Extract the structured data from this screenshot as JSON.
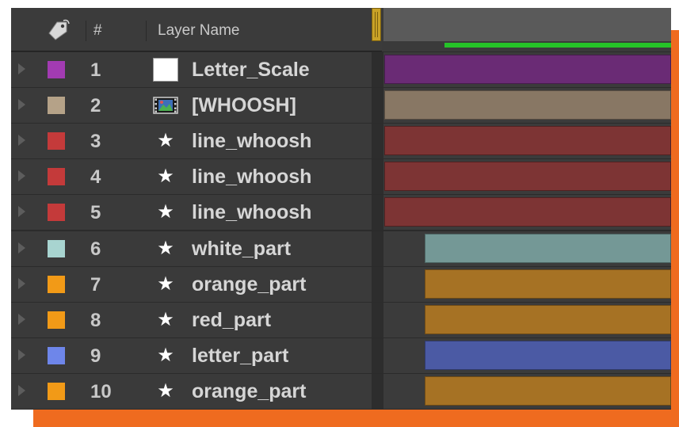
{
  "header": {
    "label_icon": "tag-icon",
    "number_label": "#",
    "layer_name_label": "Layer Name"
  },
  "layers": [
    {
      "num": "1",
      "name": "Letter_Scale",
      "label_color": "#a23bb2",
      "source_icon": "solid-icon",
      "bar_color": "#6a2b75",
      "bar_start": 0.0
    },
    {
      "num": "2",
      "name": "[WHOOSH]",
      "label_color": "#b5a288",
      "source_icon": "footage-icon",
      "bar_color": "#887764",
      "bar_start": 0.0
    },
    {
      "num": "3",
      "name": "line_whoosh",
      "label_color": "#c43a3a",
      "source_icon": "star-icon",
      "bar_color": "#7d3434",
      "bar_start": 0.0
    },
    {
      "num": "4",
      "name": "line_whoosh",
      "label_color": "#c43a3a",
      "source_icon": "star-icon",
      "bar_color": "#7d3434",
      "bar_start": 0.0
    },
    {
      "num": "5",
      "name": "line_whoosh",
      "label_color": "#c43a3a",
      "source_icon": "star-icon",
      "bar_color": "#7d3434",
      "bar_start": 0.0
    },
    {
      "num": "6",
      "name": "white_part",
      "label_color": "#a8d4d0",
      "source_icon": "star-icon",
      "bar_color": "#749896",
      "bar_start": 0.14
    },
    {
      "num": "7",
      "name": "orange_part",
      "label_color": "#f29a17",
      "source_icon": "star-icon",
      "bar_color": "#a67224",
      "bar_start": 0.14
    },
    {
      "num": "8",
      "name": "red_part",
      "label_color": "#f29a17",
      "source_icon": "star-icon",
      "bar_color": "#a67224",
      "bar_start": 0.14
    },
    {
      "num": "9",
      "name": "letter_part",
      "label_color": "#6e86ea",
      "source_icon": "star-icon",
      "bar_color": "#4b5aa4",
      "bar_start": 0.14
    },
    {
      "num": "10",
      "name": "orange_part",
      "label_color": "#f29a17",
      "source_icon": "star-icon",
      "bar_color": "#a67224",
      "bar_start": 0.14
    }
  ],
  "accent": {
    "frame": "#ef6b1f",
    "work_area": "#25c228",
    "time_handle": "#c9a227"
  }
}
